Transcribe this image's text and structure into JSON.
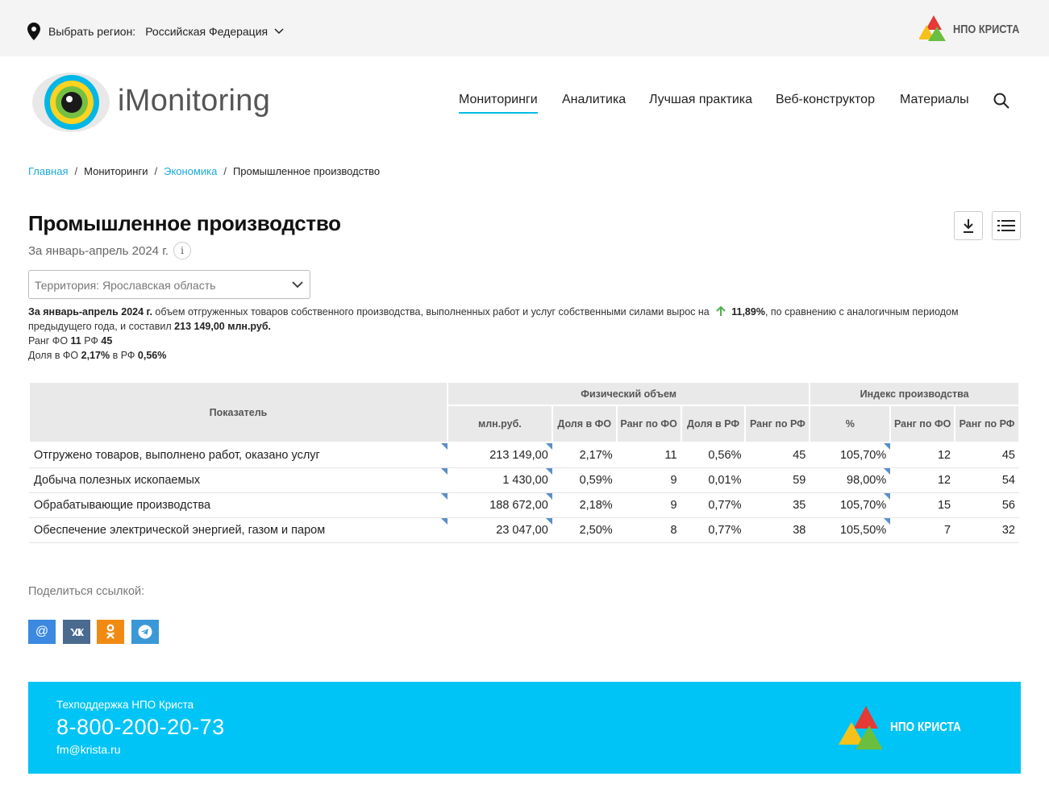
{
  "topbar": {
    "region_label": "Выбрать регион:",
    "region_value": "Российская Федерация",
    "npo_logo_text": "НПО КРИСТА"
  },
  "header": {
    "brand": "iMonitoring",
    "nav": [
      {
        "label": "Мониторинги",
        "active": true
      },
      {
        "label": "Аналитика"
      },
      {
        "label": "Лучшая практика"
      },
      {
        "label": "Веб-конструктор"
      },
      {
        "label": "Материалы"
      }
    ]
  },
  "breadcrumb": [
    "Главная",
    "Мониторинги",
    "Экономика",
    "Промышленное производство"
  ],
  "page": {
    "title": "Промышленное производство",
    "period": "За январь-апрель 2024 г.",
    "info_icon": "i",
    "territory": "Территория: Ярославская область"
  },
  "summary": {
    "period_bold": "За январь-апрель 2024 г.",
    "text_before": " объем отгруженных товаров собственного производства, выполненных работ и услуг собственными силами вырос на",
    "growth": "11,89%",
    "text_after": ", по сравнению с аналогичным периодом предыдущего года, и составил",
    "amount": "213 149,00 млн.руб.",
    "rank_label": "Ранг ФО",
    "rank_fo": "11",
    "rank_rf_label": "РФ",
    "rank_rf": "45",
    "share_label": "Доля в ФО",
    "share_fo": "2,17%",
    "share_rf_label": "в РФ",
    "share_rf": "0,56%",
    "accent_green": "#4caf50"
  },
  "table": {
    "col_indicator": "Показатель",
    "group_physical": "Физический объем",
    "group_index": "Индекс производства",
    "sub_headers": [
      "млн.руб.",
      "Доля в ФО",
      "Ранг по ФО",
      "Доля в РФ",
      "Ранг по РФ",
      "%",
      "Ранг по ФО",
      "Ранг по РФ"
    ],
    "rows": [
      {
        "name": "Отгружено товаров, выполнено работ, оказано услуг",
        "vals": [
          "213 149,00",
          "2,17%",
          "11",
          "0,56%",
          "45",
          "105,70%",
          "12",
          "45"
        ]
      },
      {
        "name": "Добыча полезных ископаемых",
        "vals": [
          "1 430,00",
          "0,59%",
          "9",
          "0,01%",
          "59",
          "98,00%",
          "12",
          "54"
        ]
      },
      {
        "name": "Обрабатывающие производства",
        "vals": [
          "188 672,00",
          "2,18%",
          "9",
          "0,77%",
          "35",
          "105,70%",
          "15",
          "56"
        ]
      },
      {
        "name": "Обеспечение электрической энергией, газом и паром",
        "vals": [
          "23 047,00",
          "2,50%",
          "8",
          "0,77%",
          "38",
          "105,50%",
          "7",
          "32"
        ]
      }
    ]
  },
  "share": {
    "label": "Поделиться ссылкой:",
    "buttons": [
      {
        "icon": "mail-icon",
        "glyph": "@",
        "color": "#3b89e0"
      },
      {
        "icon": "vk-icon",
        "glyph": "vk",
        "color": "#4a6a8f"
      },
      {
        "icon": "odnoklassniki-icon",
        "glyph": "ok",
        "color": "#f08a12"
      },
      {
        "icon": "telegram-icon",
        "glyph": "tg",
        "color": "#3b98d6"
      }
    ]
  },
  "footer": {
    "support": "Техподдержка НПО Криста",
    "phone": "8-800-200-20-73",
    "email": "fm@krista.ru",
    "npo_logo_text": "НПО КРИСТА",
    "bg_color": "#00c4f5"
  }
}
